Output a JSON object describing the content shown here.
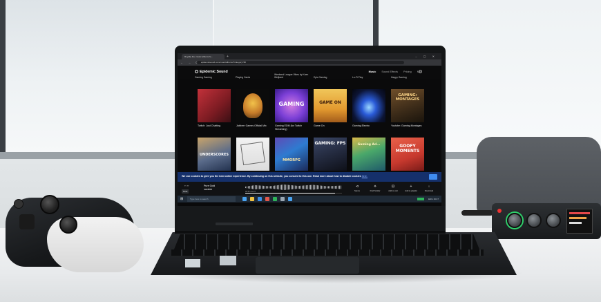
{
  "browser": {
    "tab_title": "Royalty free music albums fo...",
    "new_tab": "+",
    "window_controls": "– ▢ ✕",
    "nav_glyphs": "← → ⟳",
    "url": "epidemicsound.com/music/albums/?category=96"
  },
  "site": {
    "logo": "Epidemic Sound",
    "menu": [
      "Music",
      "Sound Effects",
      "Pricing",
      "Me"
    ]
  },
  "top_captions": [
    "Gaming Gaming",
    "Playing Cards",
    "Weekend League Vibes by Koen Weijland",
    "Epic Gaming",
    "Lo-Fi Play",
    "Happy Gaming"
  ],
  "albums_row1": [
    {
      "label": "Twitch: Just Chatting",
      "art_text": ""
    },
    {
      "label": "Jabbrrrr Games Official Mix",
      "art_text": ""
    },
    {
      "label": "Gaming EDM (for Twitch Streaming)",
      "art_text": "GAMING"
    },
    {
      "label": "Game On",
      "art_text": "GAME ON"
    },
    {
      "label": "Gaming Electro",
      "art_text": ""
    },
    {
      "label": "Youtube: Gaming Montages",
      "art_text": "GAMING: MONTAGES"
    }
  ],
  "albums_row2": [
    {
      "label": "",
      "art_text": "UNDERSCORES"
    },
    {
      "label": "",
      "art_text": ""
    },
    {
      "label": "",
      "art_text": "MMORPG"
    },
    {
      "label": "",
      "art_text": "GAMING: FPS"
    },
    {
      "label": "",
      "art_text": "Gaming Ad..."
    },
    {
      "label": "",
      "art_text": "GOOFY MOMENTS"
    }
  ],
  "cookie_banner": {
    "text": "We use cookies to give you the best online experience. By continuing on this website, you consent to this use. Read more about how to disable cookies",
    "link": "here."
  },
  "player": {
    "track": "Pure Gold",
    "artist": "xoxxlee",
    "nav_glyphs": "‹‹ ››",
    "tag": "Tune",
    "time": "00:35 / 02:27",
    "progress": 0.93,
    "actions": [
      {
        "glyph": "⊲",
        "label": "Stems"
      },
      {
        "glyph": "⟡",
        "label": "Find Similar"
      },
      {
        "glyph": "⊡",
        "label": "Add to cart"
      },
      {
        "glyph": "+",
        "label": "Add to playlist"
      },
      {
        "glyph": "↓",
        "label": "Download"
      }
    ]
  },
  "taskbar": {
    "start_glyph": "⊞",
    "search_placeholder": "Type here to search",
    "tray": "ENG  19:47"
  },
  "colors": {
    "cookie_bg": "#15306b",
    "cookie_button": "#3f8cf2",
    "recorder_ring": "#2fd06b"
  }
}
